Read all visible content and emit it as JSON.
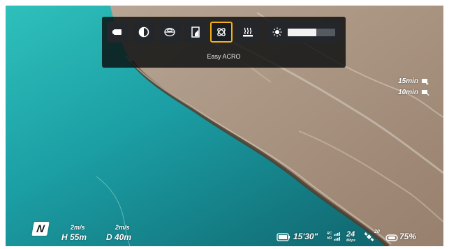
{
  "toolbar": {
    "buttons": [
      {
        "name": "video-mode",
        "icon": "camera-icon",
        "active": false
      },
      {
        "name": "contrast",
        "icon": "contrast-icon",
        "active": false
      },
      {
        "name": "gimbal",
        "icon": "gimbal-icon",
        "active": false
      },
      {
        "name": "storage",
        "icon": "sd-card-icon",
        "active": false
      },
      {
        "name": "easy-acro",
        "icon": "acro-icon",
        "active": true
      },
      {
        "name": "heating",
        "icon": "heat-icon",
        "active": false
      }
    ],
    "brightness": {
      "icon": "sun-icon",
      "level": 0.6
    },
    "mode_label": "Easy ACRO",
    "accent": "#f2b01e"
  },
  "flight_time": [
    {
      "value": "15min",
      "icon": "drone-time-icon"
    },
    {
      "value": "10min",
      "icon": "return-time-icon"
    }
  ],
  "telemetry": {
    "compass": "N",
    "horizontal_speed": "2m/s",
    "height": "H 55m",
    "vertical_speed": "2m/s",
    "distance": "D 40m"
  },
  "status": {
    "battery_time": "15'30\"",
    "signal_rc": "RC",
    "signal_hd": "HD",
    "bitrate": "24",
    "bitrate_unit": "Mbps",
    "satellites": "20",
    "goggle_battery": "75%"
  }
}
